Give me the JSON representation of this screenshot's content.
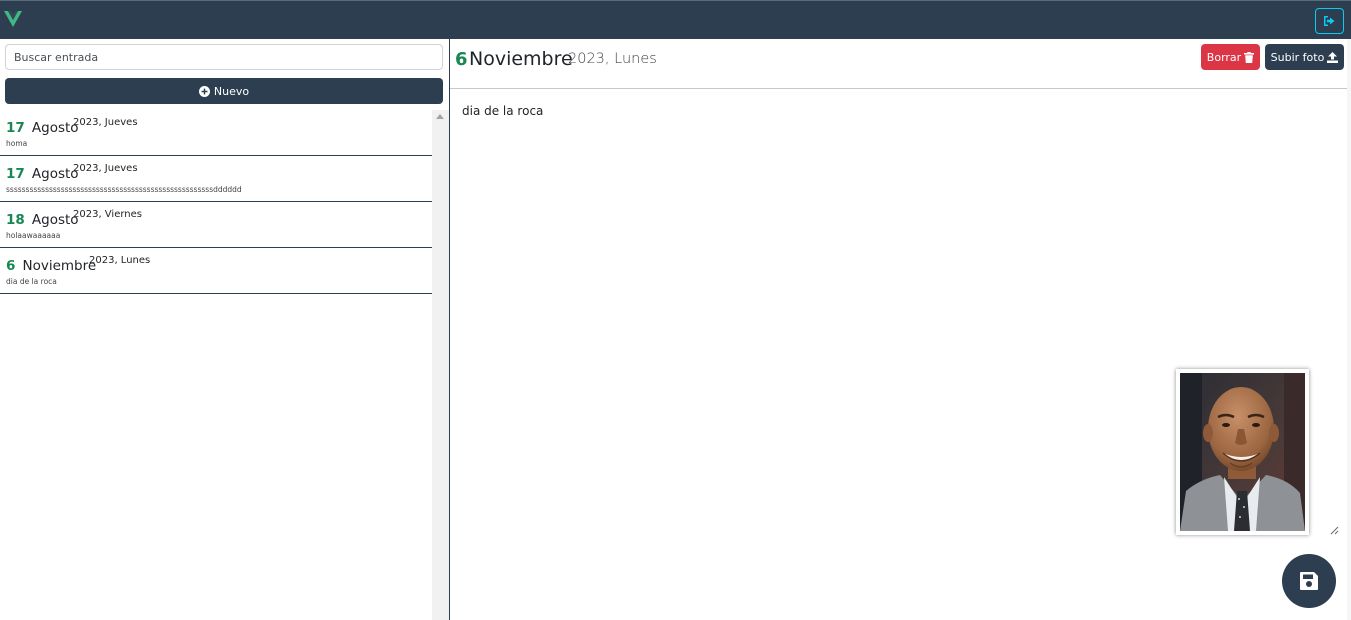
{
  "app": {
    "logo_icon": "vue-logo-icon",
    "logout_icon": "sign-out-icon",
    "colors": {
      "navbar": "#2c3e50",
      "accent_day": "#198754",
      "danger": "#dc3545",
      "info": "#0dcaf0"
    }
  },
  "sidebar": {
    "search_placeholder": "Buscar entrada",
    "new_button": {
      "label": "Nuevo",
      "icon": "plus-circle-icon"
    },
    "entries": [
      {
        "day": "17",
        "month": "Agosto",
        "yearday": "2023, Jueves",
        "snippet": "homa"
      },
      {
        "day": "17",
        "month": "Agosto",
        "yearday": "2023, Jueves",
        "snippet": "sssssssssssssssssssssssssssssssssssssssssssssssssssssdddddd"
      },
      {
        "day": "18",
        "month": "Agosto",
        "yearday": "2023, Viernes",
        "snippet": "holaawaaaaaa"
      },
      {
        "day": "6",
        "month": "Noviembre",
        "yearday": "2023, Lunes",
        "snippet": "dia de la roca"
      }
    ]
  },
  "entry_view": {
    "day": "6",
    "month": "Noviembre",
    "yearday": "2023, Lunes",
    "delete_button": {
      "label": "Borrar",
      "icon": "trash-icon"
    },
    "upload_button": {
      "label": "Subir foto",
      "icon": "upload-icon"
    },
    "text": "dia de la roca",
    "photo_icon": "portrait-photo",
    "save_icon": "floppy-disk-icon"
  }
}
